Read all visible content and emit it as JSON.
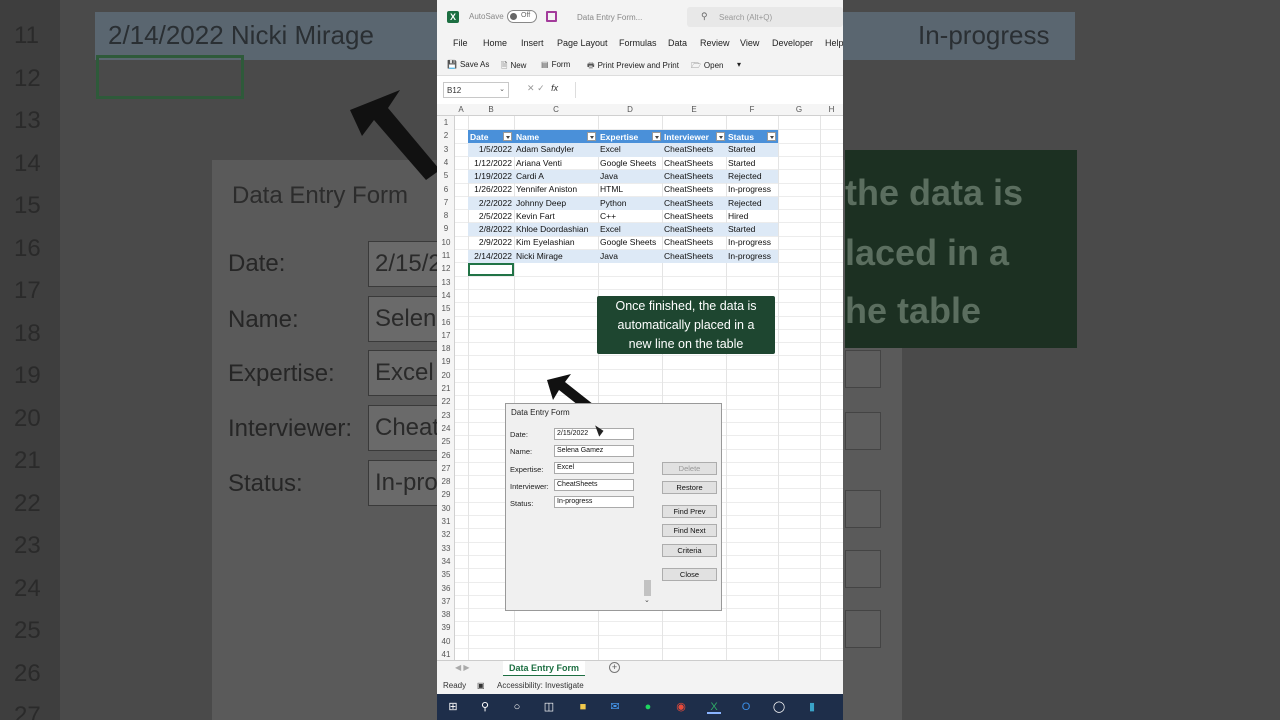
{
  "background": {
    "row_numbers": [
      "11",
      "12",
      "13",
      "14",
      "15",
      "16",
      "17",
      "18",
      "19",
      "20",
      "21",
      "22",
      "23",
      "24",
      "25",
      "26",
      "27"
    ],
    "top_row_text": "2/14/2022 Nicki Mirage",
    "top_row_status": "In-progress",
    "form_title": "Data Entry Form",
    "labels": [
      "Date:",
      "Name:",
      "Expertise:",
      "Interviewer:",
      "Status:"
    ],
    "field_values": [
      "2/15/2",
      "Selen",
      "Excel",
      "Cheat",
      "In-pro"
    ],
    "right_text": [
      "the data is",
      "laced in a",
      "he table"
    ]
  },
  "window": {
    "autosave_label": "AutoSave",
    "autosave_state": "Off",
    "doc_title": "Data Entry Form...",
    "search_placeholder": "Search (Alt+Q)"
  },
  "menu": [
    "File",
    "Home",
    "Insert",
    "Page Layout",
    "Formulas",
    "Data",
    "Review",
    "View",
    "Developer",
    "Help"
  ],
  "quick_access": {
    "save_as": "Save As",
    "new": "New",
    "form": "Form",
    "print_preview": "Print Preview and Print",
    "open": "Open"
  },
  "formula_bar": {
    "name_box": "B12",
    "fx": "fx",
    "value": ""
  },
  "columns": [
    "A",
    "B",
    "C",
    "D",
    "E",
    "F",
    "G",
    "H"
  ],
  "row_numbers": [
    "1",
    "2",
    "3",
    "4",
    "5",
    "6",
    "7",
    "8",
    "9",
    "10",
    "11",
    "12",
    "13",
    "14",
    "15",
    "16",
    "17",
    "18",
    "19",
    "20",
    "21",
    "22",
    "23",
    "24",
    "25",
    "26",
    "27",
    "28",
    "29",
    "30",
    "31",
    "32",
    "33",
    "34",
    "35",
    "36",
    "37",
    "38",
    "39",
    "40",
    "41"
  ],
  "table": {
    "headers": [
      "Date",
      "Name",
      "Expertise",
      "Interviewer",
      "Status"
    ],
    "rows": [
      [
        "1/5/2022",
        "Adam Sandyler",
        "Excel",
        "CheatSheets",
        "Started"
      ],
      [
        "1/12/2022",
        "Ariana Venti",
        "Google Sheets",
        "CheatSheets",
        "Started"
      ],
      [
        "1/19/2022",
        "Cardi A",
        "Java",
        "CheatSheets",
        "Rejected"
      ],
      [
        "1/26/2022",
        "Yennifer Aniston",
        "HTML",
        "CheatSheets",
        "In-progress"
      ],
      [
        "2/2/2022",
        "Johnny Deep",
        "Python",
        "CheatSheets",
        "Rejected"
      ],
      [
        "2/5/2022",
        "Kevin Fart",
        "C++",
        "CheatSheets",
        "Hired"
      ],
      [
        "2/8/2022",
        "Khloe Doordashian",
        "Excel",
        "CheatSheets",
        "Started"
      ],
      [
        "2/9/2022",
        "Kim Eyelashian",
        "Google Sheets",
        "CheatSheets",
        "In-progress"
      ],
      [
        "2/14/2022",
        "Nicki Mirage",
        "Java",
        "CheatSheets",
        "In-progress"
      ]
    ]
  },
  "dialog": {
    "title": "Data Entry Form",
    "fields": [
      {
        "label": "Date:",
        "value": "2/15/2022"
      },
      {
        "label": "Name:",
        "value": "Selena Gamez"
      },
      {
        "label": "Expertise:",
        "value": "Excel"
      },
      {
        "label": "Interviewer:",
        "value": "CheatSheets"
      },
      {
        "label": "Status:",
        "value": "In-progress"
      }
    ],
    "buttons": {
      "delete": "Delete",
      "restore": "Restore",
      "find_prev": "Find Prev",
      "find_next": "Find Next",
      "criteria": "Criteria",
      "close": "Close"
    }
  },
  "callout": {
    "lines": [
      "Once finished, the data is",
      "automatically placed in a",
      "new line on the table"
    ]
  },
  "sheet_tab": "Data Entry Form",
  "status_bar": {
    "ready": "Ready",
    "accessibility": "Accessibility: Investigate"
  },
  "colors": {
    "excel_green": "#1d6f42",
    "table_header": "#4a90d9",
    "table_band": "#dde9f6",
    "callout_bg": "#1e4630",
    "taskbar": "#1e2e4a"
  },
  "taskbar_icons": [
    "windows-start-icon",
    "search-icon",
    "cortana-icon",
    "task-view-icon",
    "file-explorer-icon",
    "mail-icon",
    "spotify-icon",
    "chrome-icon",
    "excel-icon",
    "outlook-icon",
    "obs-icon",
    "app-icon"
  ]
}
